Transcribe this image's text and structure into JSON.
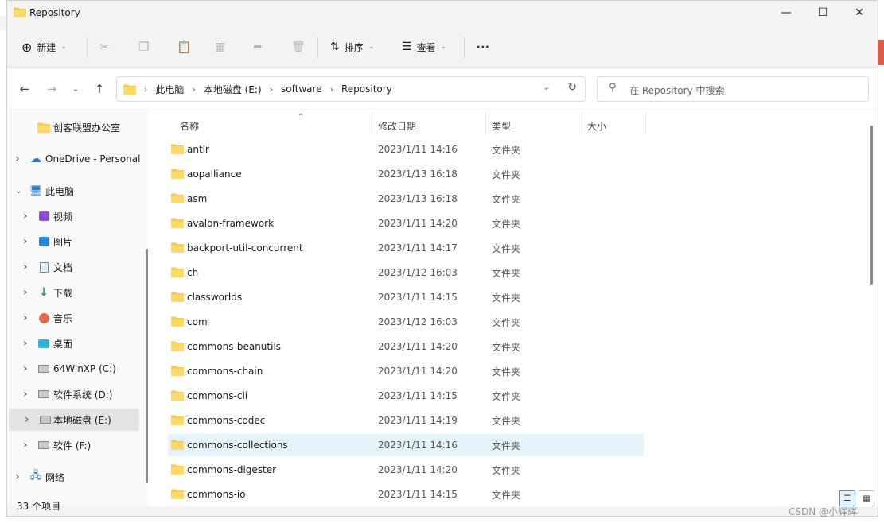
{
  "window": {
    "title": "Repository"
  },
  "toolbar": {
    "new_label": "新建",
    "sort_label": "排序",
    "view_label": "查看",
    "more_label": "···"
  },
  "address": {
    "crumbs": [
      "此电脑",
      "本地磁盘 (E:)",
      "software",
      "Repository"
    ]
  },
  "search": {
    "placeholder": "在 Repository 中搜索"
  },
  "sidebar": {
    "items": [
      {
        "label": "创客联盟办公室",
        "icon": "folder-icon",
        "expandable": false,
        "indent": 1
      },
      {
        "label": "OneDrive - Personal",
        "icon": "cloud-icon",
        "expandable": true,
        "indent": 0
      },
      {
        "label": "此电脑",
        "icon": "computer-icon",
        "expandable": true,
        "expanded": true,
        "indent": 0
      },
      {
        "label": "视频",
        "icon": "video-icon",
        "expandable": true,
        "indent": 1
      },
      {
        "label": "图片",
        "icon": "picture-icon",
        "expandable": true,
        "indent": 1
      },
      {
        "label": "文档",
        "icon": "document-icon",
        "expandable": true,
        "indent": 1
      },
      {
        "label": "下载",
        "icon": "download-icon",
        "expandable": true,
        "indent": 1
      },
      {
        "label": "音乐",
        "icon": "music-icon",
        "expandable": true,
        "indent": 1
      },
      {
        "label": "桌面",
        "icon": "desktop-icon",
        "expandable": true,
        "indent": 1
      },
      {
        "label": "64WinXP (C:)",
        "icon": "drive-icon",
        "expandable": true,
        "indent": 1
      },
      {
        "label": "软件系统 (D:)",
        "icon": "drive-icon",
        "expandable": true,
        "indent": 1
      },
      {
        "label": "本地磁盘 (E:)",
        "icon": "drive-icon",
        "expandable": true,
        "indent": 1,
        "selected": true
      },
      {
        "label": "软件 (F:)",
        "icon": "drive-icon",
        "expandable": true,
        "indent": 1
      },
      {
        "label": "网络",
        "icon": "network-icon",
        "expandable": true,
        "indent": 0
      }
    ]
  },
  "status": {
    "item_count": "33 个项目"
  },
  "columns": {
    "name": "名称",
    "date": "修改日期",
    "type": "类型",
    "size": "大小"
  },
  "files": [
    {
      "name": "antlr",
      "date": "2023/1/11 14:16",
      "type": "文件夹"
    },
    {
      "name": "aopalliance",
      "date": "2023/1/13 16:18",
      "type": "文件夹"
    },
    {
      "name": "asm",
      "date": "2023/1/13 16:18",
      "type": "文件夹"
    },
    {
      "name": "avalon-framework",
      "date": "2023/1/11 14:20",
      "type": "文件夹"
    },
    {
      "name": "backport-util-concurrent",
      "date": "2023/1/11 14:17",
      "type": "文件夹"
    },
    {
      "name": "ch",
      "date": "2023/1/12 16:03",
      "type": "文件夹"
    },
    {
      "name": "classworlds",
      "date": "2023/1/11 14:15",
      "type": "文件夹"
    },
    {
      "name": "com",
      "date": "2023/1/12 16:03",
      "type": "文件夹"
    },
    {
      "name": "commons-beanutils",
      "date": "2023/1/11 14:20",
      "type": "文件夹"
    },
    {
      "name": "commons-chain",
      "date": "2023/1/11 14:20",
      "type": "文件夹"
    },
    {
      "name": "commons-cli",
      "date": "2023/1/11 14:15",
      "type": "文件夹"
    },
    {
      "name": "commons-codec",
      "date": "2023/1/11 14:19",
      "type": "文件夹"
    },
    {
      "name": "commons-collections",
      "date": "2023/1/11 14:16",
      "type": "文件夹",
      "selected": true
    },
    {
      "name": "commons-digester",
      "date": "2023/1/11 14:20",
      "type": "文件夹"
    },
    {
      "name": "commons-io",
      "date": "2023/1/11 14:15",
      "type": "文件夹"
    }
  ],
  "watermark": "CSDN @小辉辉",
  "colors": {
    "folder": "#f7c948",
    "folder_dark": "#e0a800",
    "selection": "#e5f3ff",
    "accent": "#0067c0"
  }
}
